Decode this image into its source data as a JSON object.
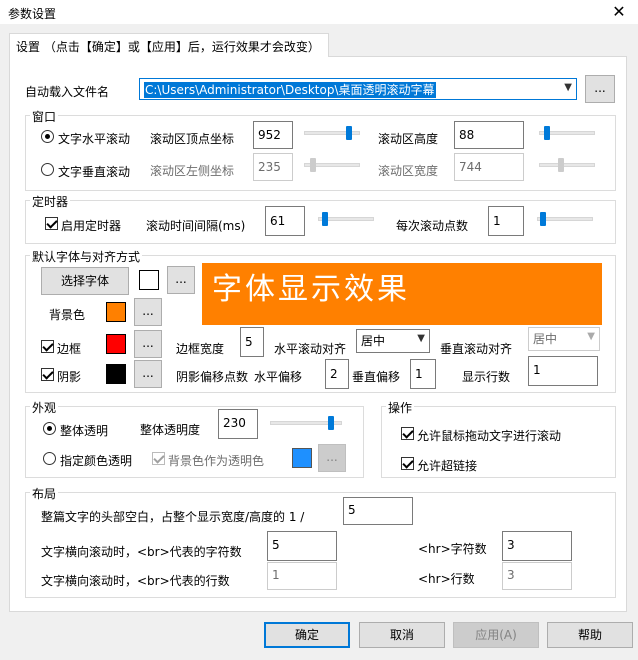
{
  "window": {
    "title": "参数设置",
    "close": "✕"
  },
  "tab": {
    "label": "设置 （点击【确定】或【应用】后，运行效果才会改变）"
  },
  "autoload": {
    "label": "自动载入文件名",
    "value": "C:\\Users\\Administrator\\Desktop\\桌面透明滚动字幕",
    "browse": "..."
  },
  "window_group": {
    "title": "窗口",
    "horizontal_label": "文字水平滚动",
    "vertical_label": "文字垂直滚动",
    "top_label": "滚动区顶点坐标",
    "top_value": "952",
    "height_label": "滚动区高度",
    "height_value": "88",
    "left_label": "滚动区左侧坐标",
    "left_value": "235",
    "width_label": "滚动区宽度",
    "width_value": "744"
  },
  "timer": {
    "title": "定时器",
    "enable_label": "启用定时器",
    "interval_label": "滚动时间间隔(ms)",
    "interval_value": "61",
    "step_label": "每次滚动点数",
    "step_value": "1"
  },
  "font": {
    "title": "默认字体与对齐方式",
    "choose_font": "选择字体",
    "preview_text": "字体显示效果",
    "bg_label": "背景色",
    "border_label": "边框",
    "border_width_label": "边框宽度",
    "border_width_value": "5",
    "h_align_label": "水平滚动对齐",
    "h_align_value": "居中",
    "v_align_label": "垂直滚动对齐",
    "v_align_value": "居中",
    "shadow_label": "阴影",
    "shadow_offset_label": "阴影偏移点数",
    "h_offset_label": "水平偏移",
    "h_offset_value": "2",
    "v_offset_label": "垂直偏移",
    "v_offset_value": "1",
    "rows_label": "显示行数",
    "rows_value": "1",
    "more": "...",
    "colors": {
      "font": "#ffffff",
      "bg": "#ff8000",
      "border": "#ff0000",
      "shadow": "#000000",
      "preview_text": "#ffffff"
    }
  },
  "appearance": {
    "title": "外观",
    "whole_label": "整体透明",
    "whole_opacity_label": "整体透明度",
    "whole_opacity_value": "230",
    "color_label": "指定颜色透明",
    "bg_as_transparent_label": "背景色作为透明色",
    "more": "...",
    "transparent_color": "#1e90ff"
  },
  "ops": {
    "title": "操作",
    "drag_label": "允许鼠标拖动文字进行滚动",
    "link_label": "允许超链接"
  },
  "layout": {
    "title": "布局",
    "head_blank_label": "整篇文字的头部空白，占整个显示宽度/高度的 1 /",
    "head_blank_value": "5",
    "br_chars_label": "文字横向滚动时，<br>代表的字符数",
    "br_chars_value": "5",
    "hr_chars_label": "<hr>字符数",
    "hr_chars_value": "3",
    "br_rows_label": "文字横向滚动时，<br>代表的行数",
    "br_rows_value": "1",
    "hr_rows_label": "<hr>行数",
    "hr_rows_value": "3"
  },
  "footer": {
    "ok": "确定",
    "cancel": "取消",
    "apply": "应用(A)",
    "help": "帮助"
  }
}
